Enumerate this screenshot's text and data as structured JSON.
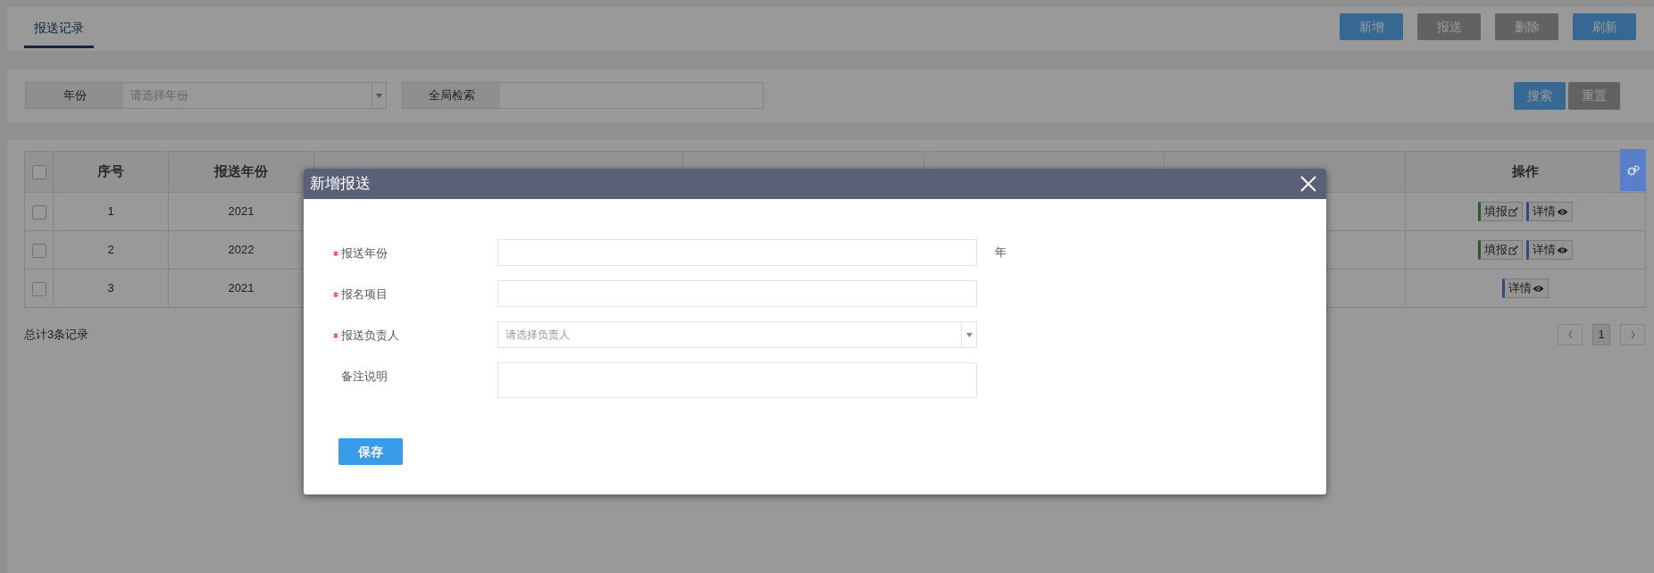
{
  "tabs": [
    {
      "label": "报送记录",
      "selected": true
    }
  ],
  "toolbar_buttons": [
    {
      "label": "新增",
      "disabled": false
    },
    {
      "label": "报送",
      "disabled": true
    },
    {
      "label": "删除",
      "disabled": true
    },
    {
      "label": "刷新",
      "disabled": false
    }
  ],
  "filters": {
    "year": {
      "label": "年份",
      "placeholder": "请选择年份"
    },
    "search": {
      "label": "全局检索"
    }
  },
  "search_buttons": [
    {
      "label": "搜索",
      "disabled": false
    },
    {
      "label": "重置",
      "disabled": true
    }
  ],
  "table": {
    "all_checked": false,
    "columns": [
      "序号",
      "报送年份",
      "操作"
    ],
    "rows": [
      {
        "checked": false,
        "cells": [
          "1",
          "2021"
        ],
        "actions": [
          {
            "label": "填报",
            "kind": "fill"
          },
          {
            "label": "详情",
            "kind": "detail"
          }
        ]
      },
      {
        "checked": false,
        "cells": [
          "2",
          "2022"
        ],
        "actions": [
          {
            "label": "填报",
            "kind": "fill"
          },
          {
            "label": "详情",
            "kind": "detail"
          }
        ]
      },
      {
        "checked": false,
        "cells": [
          "3",
          "2021"
        ],
        "actions": [
          {
            "label": "详情",
            "kind": "detail"
          }
        ]
      }
    ]
  },
  "footer": "总计3条记录",
  "pagination": {
    "pages": [
      {
        "label": "1",
        "selected": true
      }
    ]
  },
  "dialog": {
    "title": "新增报送",
    "fields": [
      {
        "label": "报送年份",
        "required": true,
        "kind": "text",
        "suffix": "年"
      },
      {
        "label": "报名项目",
        "required": true,
        "kind": "text"
      },
      {
        "label": "报送负责人",
        "required": true,
        "kind": "select",
        "placeholder": "请选择负责人"
      },
      {
        "label": "备注说明",
        "required": false,
        "kind": "textarea"
      }
    ],
    "save_button": "保存"
  }
}
